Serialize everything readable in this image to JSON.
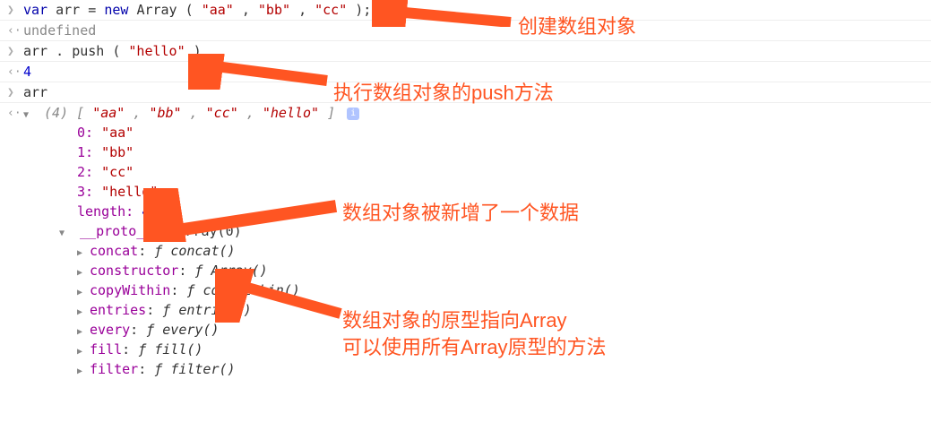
{
  "line1": {
    "var": "var",
    "name": "arr",
    "eq": " = ",
    "new": "new",
    "cls": " Array",
    "paren_open": "(",
    "a1": "\"aa\"",
    "c1": ",",
    "a2": "\"bb\"",
    "c2": ",",
    "a3": "\"cc\"",
    "paren_close": ");"
  },
  "line2": {
    "result": "undefined"
  },
  "line3": {
    "obj": "arr",
    "dot": ".",
    "method": "push",
    "paren_open": "(",
    "arg": "\"hello\"",
    "paren_close": ")"
  },
  "line4": {
    "result": "4"
  },
  "line5": {
    "input": "arr"
  },
  "preview": {
    "len": "(4)",
    "open": " [",
    "v0": "\"aa\"",
    "c0": ", ",
    "v1": "\"bb\"",
    "c1": ", ",
    "v2": "\"cc\"",
    "c2": ", ",
    "v3": "\"hello\"",
    "close": "]"
  },
  "items": {
    "i0k": "0: ",
    "i0v": "\"aa\"",
    "i1k": "1: ",
    "i1v": "\"bb\"",
    "i2k": "2: ",
    "i2v": "\"cc\"",
    "i3k": "3: ",
    "i3v": "\"hello\"",
    "lenk": "length: ",
    "lenv": "4",
    "protok": "__proto__",
    "protov": ": Array(0)"
  },
  "proto_methods": [
    {
      "name": "concat",
      "sig": "concat()"
    },
    {
      "name": "constructor",
      "sig": "Array()"
    },
    {
      "name": "copyWithin",
      "sig": "copyWithin()"
    },
    {
      "name": "entries",
      "sig": "entries()"
    },
    {
      "name": "every",
      "sig": "every()"
    },
    {
      "name": "fill",
      "sig": "fill()"
    },
    {
      "name": "filter",
      "sig": "filter()"
    }
  ],
  "annotations": {
    "a1": "创建数组对象",
    "a2": "执行数组对象的push方法",
    "a3": "数组对象被新增了一个数据",
    "a4_l1": "数组对象的原型指向Array",
    "a4_l2": "可以使用所有Array原型的方法"
  },
  "gutters": {
    "prompt": "❯",
    "return": "‹·"
  }
}
